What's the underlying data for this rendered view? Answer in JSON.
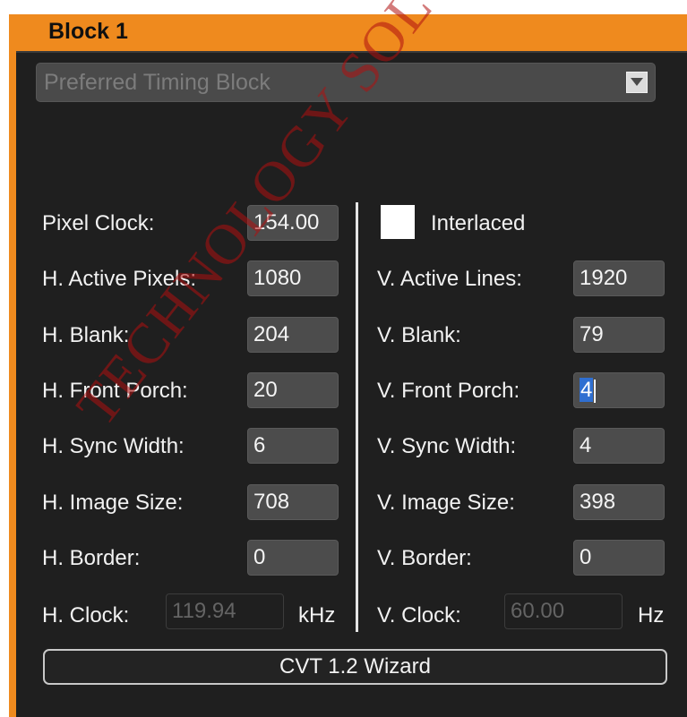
{
  "panel": {
    "title": "Block 1"
  },
  "timing_type": {
    "selected": "Preferred Timing Block"
  },
  "horizontal": {
    "pixel_clock": {
      "label": "Pixel Clock:",
      "value": "154.00"
    },
    "active_pixels": {
      "label": "H. Active Pixels:",
      "value": "1080"
    },
    "blank": {
      "label": "H. Blank:",
      "value": "204"
    },
    "front_porch": {
      "label": "H. Front Porch:",
      "value": "20"
    },
    "sync_width": {
      "label": "H. Sync Width:",
      "value": "6"
    },
    "image_size": {
      "label": "H. Image Size:",
      "value": "708"
    },
    "border": {
      "label": "H. Border:",
      "value": "0"
    },
    "clock": {
      "label": "H. Clock:",
      "value": "119.94",
      "unit": "kHz"
    }
  },
  "vertical": {
    "interlaced": {
      "label": "Interlaced",
      "checked": false
    },
    "active_lines": {
      "label": "V. Active Lines:",
      "value": "1920"
    },
    "blank": {
      "label": "V. Blank:",
      "value": "79"
    },
    "front_porch": {
      "label": "V. Front Porch:",
      "value": "4"
    },
    "sync_width": {
      "label": "V. Sync Width:",
      "value": "4"
    },
    "image_size": {
      "label": "V. Image Size:",
      "value": "398"
    },
    "border": {
      "label": "V. Border:",
      "value": "0"
    },
    "clock": {
      "label": "V. Clock:",
      "value": "60.00",
      "unit": "Hz"
    }
  },
  "wizard_button": {
    "label": "CVT 1.2 Wizard"
  },
  "watermark": {
    "text": "TECHNOLOGY SOLUTIONS C"
  },
  "colors": {
    "accent": "#ef8a1e",
    "panel_bg": "#1f1f1f",
    "field_bg": "#4c4c4c",
    "selection": "#2f6fd1",
    "watermark": "#b01010"
  },
  "icons": {
    "dropdown": "chevron-down-icon"
  }
}
